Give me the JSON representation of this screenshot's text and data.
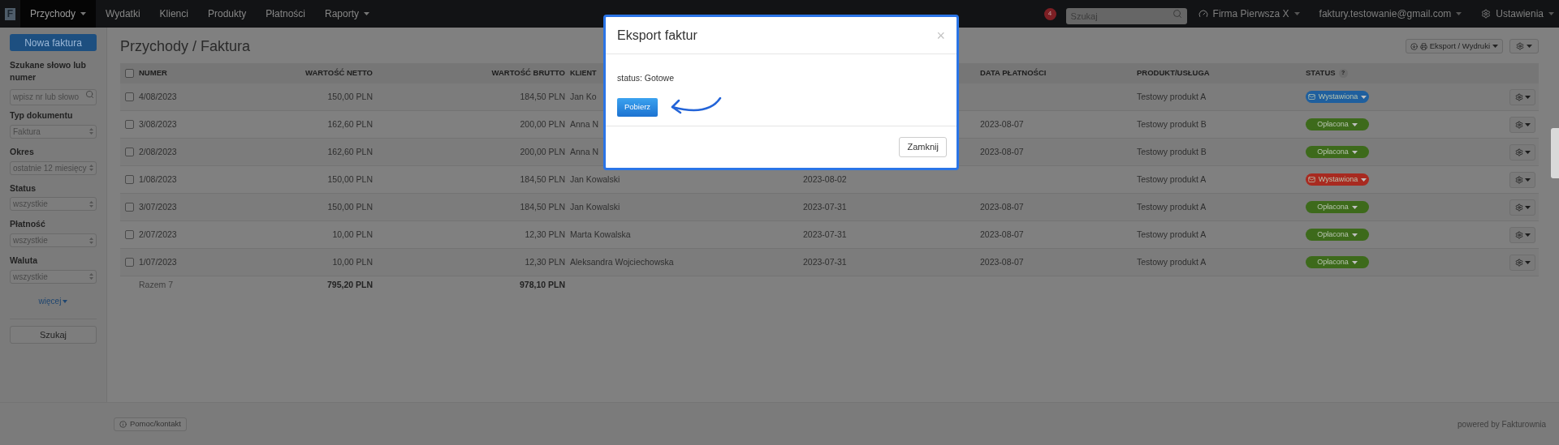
{
  "nav": {
    "logo": "F",
    "items": [
      {
        "label": "Przychody",
        "selected": true,
        "menu": true
      },
      {
        "label": "Wydatki",
        "selected": false,
        "menu": false
      },
      {
        "label": "Klienci",
        "selected": false,
        "menu": false
      },
      {
        "label": "Produkty",
        "selected": false,
        "menu": false
      },
      {
        "label": "Płatności",
        "selected": false,
        "menu": false
      },
      {
        "label": "Raporty",
        "selected": false,
        "menu": true
      }
    ],
    "notifications": "4",
    "search": {
      "placeholder": "Szukaj"
    },
    "company": "Firma Pierwsza X",
    "user": "faktury.testowanie@gmail.com",
    "settings": "Ustawienia"
  },
  "sidebar": {
    "new_button": "Nowa faktura",
    "search": {
      "label": "Szukane słowo lub numer",
      "placeholder": "wpisz nr lub słowo"
    },
    "filters": [
      {
        "label": "Typ dokumentu",
        "value": "Faktura"
      },
      {
        "label": "Okres",
        "value": "ostatnie 12 miesięcy"
      },
      {
        "label": "Status",
        "value": "wszystkie"
      },
      {
        "label": "Płatność",
        "value": "wszystkie"
      },
      {
        "label": "Waluta",
        "value": "wszystkie"
      }
    ],
    "more": "więcej",
    "search_button": "Szukaj"
  },
  "main": {
    "title": "Przychody / Faktura",
    "export_button": "Eksport / Wydruki"
  },
  "table": {
    "headers": {
      "number": "NUMER",
      "net": "WARTOŚĆ NETTO",
      "gross": "WARTOŚĆ BRUTTO",
      "client": "KLIENT",
      "payment_date": "DATA PŁATNOŚCI",
      "product": "PRODUKT/USŁUGA",
      "status": "STATUS",
      "status_help": "?"
    },
    "all_checked": false,
    "rows": [
      {
        "checked": false,
        "number": "4/08/2023",
        "net": "150,00 PLN",
        "gross": "184,50 PLN",
        "client": "Jan Ko",
        "product": "Testowy produkt A",
        "status": {
          "kind": "sent",
          "label": "Wystawiona",
          "color": "#1f5f9e"
        }
      },
      {
        "checked": false,
        "number": "3/08/2023",
        "net": "162,60 PLN",
        "gross": "200,00 PLN",
        "client": "Anna N",
        "payment_date": "2023-08-07",
        "product": "Testowy produkt B",
        "status": {
          "kind": "paid",
          "label": "Opłacona",
          "color": "#3d6a1b"
        }
      },
      {
        "checked": false,
        "number": "2/08/2023",
        "net": "162,60 PLN",
        "gross": "200,00 PLN",
        "client": "Anna N",
        "payment_date": "2023-08-07",
        "product": "Testowy produkt B",
        "status": {
          "kind": "paid",
          "label": "Opłacona",
          "color": "#3d6a1b"
        }
      },
      {
        "checked": false,
        "number": "1/08/2023",
        "net": "150,00 PLN",
        "gross": "184,50 PLN",
        "client": "Jan Kowalski",
        "column_5": "2023-08-02",
        "product": "Testowy produkt A",
        "status": {
          "kind": "sent",
          "label": "Wystawiona",
          "color": "#a82a20"
        }
      },
      {
        "checked": false,
        "number": "3/07/2023",
        "net": "150,00 PLN",
        "gross": "184,50 PLN",
        "client": "Jan Kowalski",
        "column_5": "2023-07-31",
        "payment_date": "2023-08-07",
        "product": "Testowy produkt A",
        "status": {
          "kind": "paid",
          "label": "Opłacona",
          "color": "#3d6a1b"
        }
      },
      {
        "checked": false,
        "number": "2/07/2023",
        "net": "10,00 PLN",
        "gross": "12,30 PLN",
        "client": "Marta Kowalska",
        "column_5": "2023-07-31",
        "payment_date": "2023-08-07",
        "product": "Testowy produkt A",
        "status": {
          "kind": "paid",
          "label": "Opłacona",
          "color": "#3d6a1b"
        }
      },
      {
        "checked": false,
        "number": "1/07/2023",
        "net": "10,00 PLN",
        "gross": "12,30 PLN",
        "client": "Aleksandra Wojciechowska",
        "column_5": "2023-07-31",
        "payment_date": "2023-08-07",
        "product": "Testowy produkt A",
        "status": {
          "kind": "paid",
          "label": "Opłacona",
          "color": "#3d6a1b"
        }
      }
    ],
    "totals": {
      "label": "Razem 7",
      "net": "795,20 PLN",
      "gross": "978,10 PLN"
    }
  },
  "modal": {
    "title": "Eksport faktur",
    "close": "×",
    "status_text": "status: Gotowe",
    "download_button": "Pobierz",
    "close_button": "Zamknij"
  },
  "footer": {
    "help": "Pomoc/kontakt",
    "powered": "powered by Fakturownia"
  }
}
